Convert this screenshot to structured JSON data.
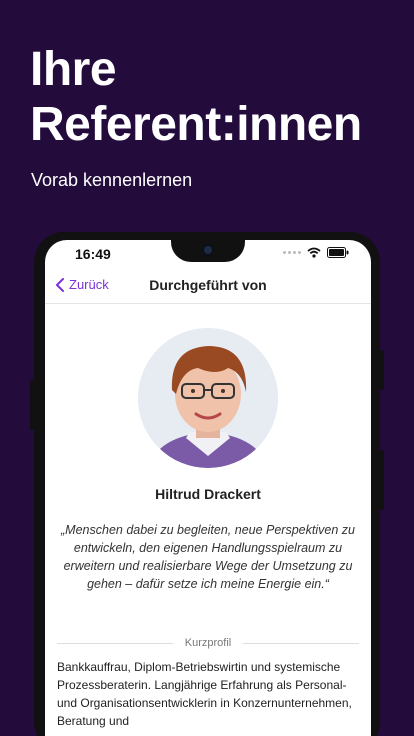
{
  "hero": {
    "title_line1": "Ihre",
    "title_line2": "Referent:innen",
    "subtitle": "Vorab kennenlernen"
  },
  "status": {
    "time": "16:49"
  },
  "nav": {
    "back_label": "Zurück",
    "title": "Durchgeführt von"
  },
  "speaker": {
    "name": "Hiltrud Drackert",
    "quote": "„Menschen dabei zu begleiten, neue Perspektiven zu entwickeln, den eigenen Handlungsspielraum zu erweitern und realisierbare Wege der Umsetzung zu gehen – dafür setze ich meine Energie ein.“"
  },
  "profile": {
    "heading": "Kurzprofil",
    "text": "Bankkauffrau, Diplom-Betriebswirtin und systemische Prozessberaterin. Langjährige Erfahrung als Personal- und Organisationsentwicklerin in Konzernunternehmen, Beratung und"
  },
  "colors": {
    "background": "#230b3c",
    "accent": "#7a33d6"
  },
  "icons": [
    "chevron-left-icon",
    "wifi-icon",
    "battery-icon",
    "signal-dots-icon"
  ]
}
